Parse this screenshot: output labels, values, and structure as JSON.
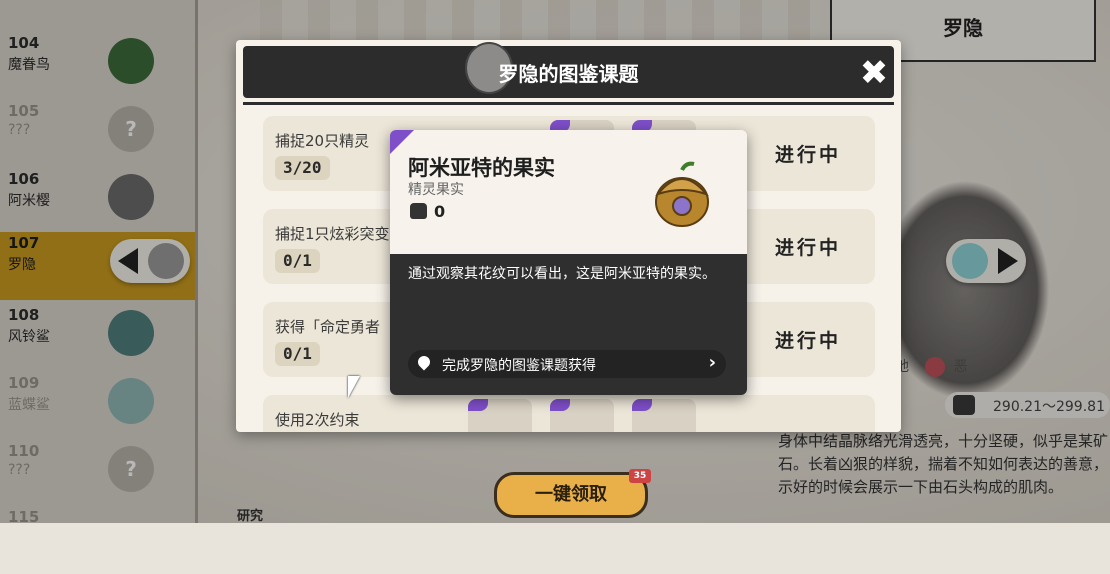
{
  "sidebar": {
    "items": [
      {
        "num": "104",
        "name": "魔眷鸟",
        "avatar": "bird-icon",
        "dim": false
      },
      {
        "num": "105",
        "name": "???",
        "avatar": "unknown-icon",
        "dim": true
      },
      {
        "num": "106",
        "name": "阿米樱",
        "avatar": "creature-icon",
        "dim": false
      },
      {
        "num": "107",
        "name": "罗隐",
        "avatar": "creature-icon",
        "dim": false,
        "selected": true
      },
      {
        "num": "108",
        "name": "风铃鲨",
        "avatar": "shark-icon",
        "dim": false
      },
      {
        "num": "109",
        "name": "蓝蝶鲨",
        "avatar": "rabbit-icon",
        "dim": true
      },
      {
        "num": "110",
        "name": "???",
        "avatar": "unknown-icon",
        "dim": true
      },
      {
        "num": "115",
        "name": "",
        "avatar": "creature-icon",
        "dim": true
      }
    ]
  },
  "right_panel": {
    "title": "罗隐",
    "types": {
      "left_fragment": "地",
      "evil": "恶"
    },
    "range": "290.21～299.81",
    "description": "身体中结晶脉络光滑透亮，十分坚硬，似乎是某矿石。长着凶狠的样貌，揣着不知如何表达的善意，示好的时候会展示一下由石头构成的肌肉。"
  },
  "research_label": "研究",
  "modal": {
    "title": "罗隐的图鉴课题",
    "close_icon": "close-icon",
    "tasks": [
      {
        "label": "捕捉20只精灵",
        "progress": "3/20",
        "status": "进行中"
      },
      {
        "label": "捕捉1只炫彩突变",
        "progress": "0/1",
        "status": "进行中"
      },
      {
        "label": "获得「命定勇者",
        "progress": "0/1",
        "status": "进行中"
      },
      {
        "label": "使用2次约束",
        "progress": "",
        "status": ""
      }
    ]
  },
  "popup": {
    "item_name": "阿米亚特的果实",
    "item_type": "精灵果实",
    "count": "0",
    "description": "通过观察其花纹可以看出，这是阿米亚特的果实。",
    "source": "完成罗隐的图鉴课题获得",
    "rarity_color": "#7e4fc9"
  },
  "claim_all": {
    "label": "一键领取",
    "badge": "35"
  }
}
